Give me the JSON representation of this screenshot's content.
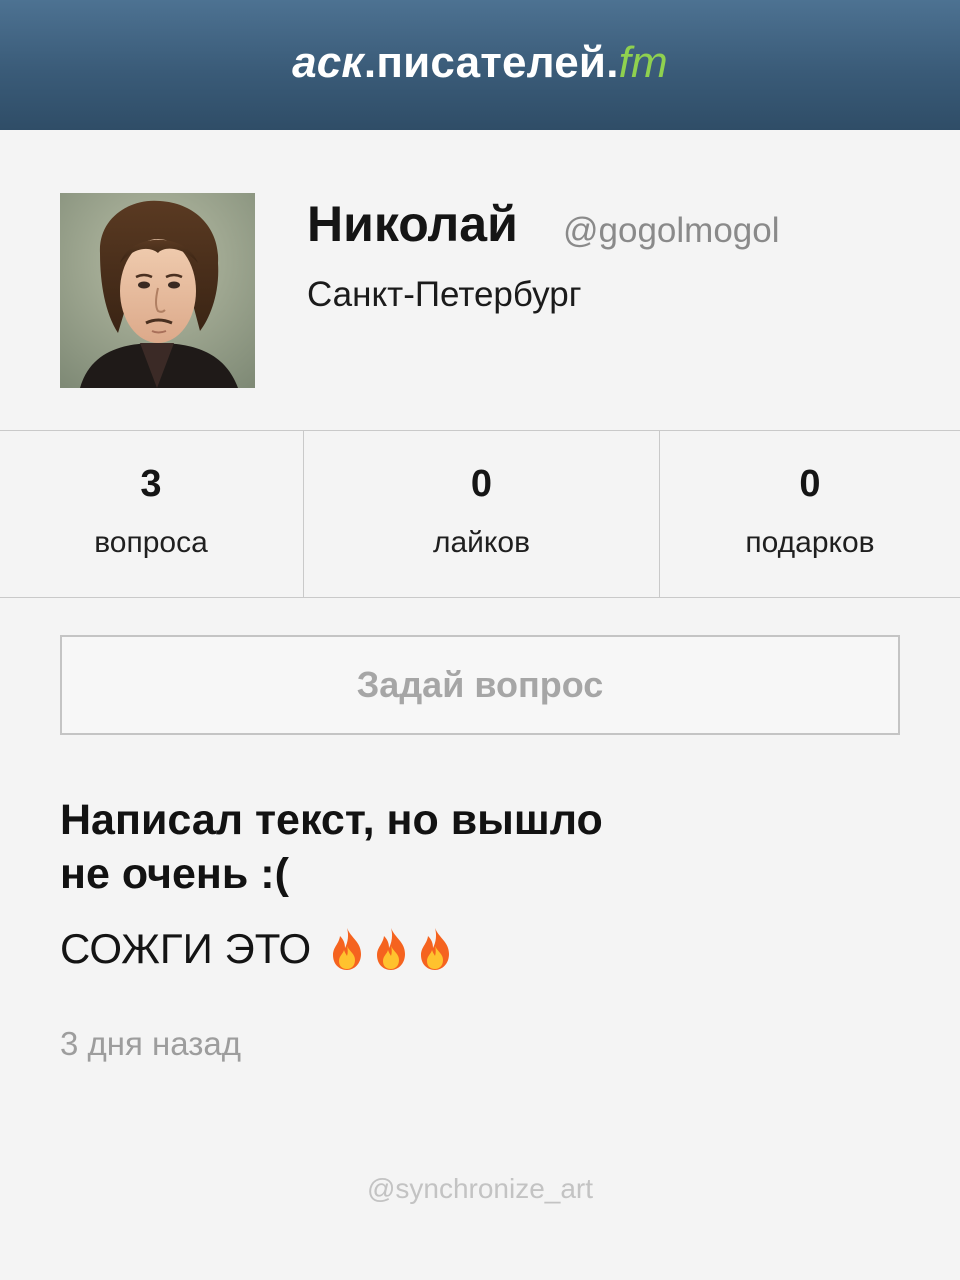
{
  "header": {
    "logo_prefix": "аск",
    "logo_dot": ".",
    "logo_main": "писателей",
    "logo_dot2": ".",
    "logo_tld": "fm"
  },
  "profile": {
    "name": "Николай",
    "handle": "@gogolmogol",
    "city": "Санкт-Петербург"
  },
  "stats": [
    {
      "value": "3",
      "label": "вопроса"
    },
    {
      "value": "0",
      "label": "лайков"
    },
    {
      "value": "0",
      "label": "подарков"
    }
  ],
  "ask_button": {
    "label": "Задай вопрос"
  },
  "post": {
    "question": "Написал текст, но вышло не очень :(",
    "answer": "СОЖГИ ЭТО",
    "answer_icons": [
      "fire-icon",
      "fire-icon",
      "fire-icon"
    ],
    "time": "3 дня назад"
  },
  "watermark": "@synchronize_art",
  "colors": {
    "header_top": "#4d7292",
    "header_bottom": "#2f4d67",
    "logo_accent": "#8fd14f",
    "background": "#f4f4f4",
    "muted_text": "#9d9d9d"
  }
}
